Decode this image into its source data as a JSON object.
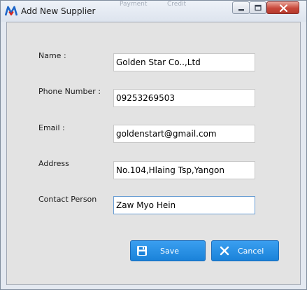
{
  "window": {
    "title": "Add New Supplier",
    "background_ghost": [
      "Payment",
      "Credit"
    ]
  },
  "title_controls": {
    "minimize_icon": "minimize-icon",
    "maximize_icon": "maximize-icon",
    "close_icon": "close-icon"
  },
  "form": {
    "fields": [
      {
        "label": "Name :",
        "value": "Golden Star Co..,Ltd"
      },
      {
        "label": "Phone Number :",
        "value": "09253269503"
      },
      {
        "label": "Email :",
        "value": "goldenstart@gmail.com"
      },
      {
        "label": "Address",
        "value": "No.104,Hlaing Tsp,Yangon"
      },
      {
        "label": "Contact Person",
        "value": "Zaw Myo Hein"
      }
    ]
  },
  "buttons": {
    "save": {
      "label": "Save",
      "icon": "floppy-disk-icon"
    },
    "cancel": {
      "label": "Cancel",
      "icon": "x-icon"
    }
  },
  "colors": {
    "button_blue": "#1a82d9",
    "close_red": "#c8483a",
    "logo_blue": "#1e66c8",
    "logo_red": "#d7261f"
  }
}
